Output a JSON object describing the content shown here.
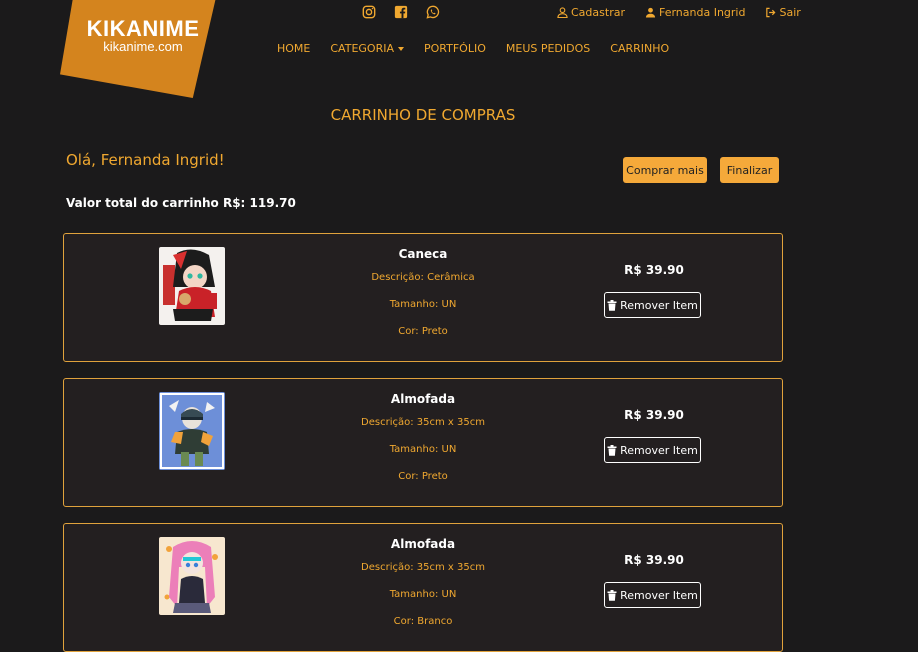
{
  "brand": {
    "name": "KIKANIME",
    "domain": "kikanime.com",
    "color": "#d4841e"
  },
  "social": [
    "instagram-icon",
    "facebook-icon",
    "whatsapp-icon"
  ],
  "user_nav": {
    "register": "Cadastrar",
    "user": "Fernanda Ingrid",
    "logout": "Sair"
  },
  "nav": {
    "home": "HOME",
    "category": "CATEGORIA",
    "portfolio": "PORTFÓLIO",
    "orders": "MEUS PEDIDOS",
    "cart": "CARRINHO"
  },
  "page": {
    "title": "CARRINHO DE COMPRAS",
    "greeting": "Olá, Fernanda Ingrid!",
    "buy_more": "Comprar mais",
    "finish": "Finalizar",
    "total_label": "Valor total do carrinho R$: 119.70"
  },
  "items": [
    {
      "name": "Caneca",
      "description": "Descrição: Cerâmica",
      "size": "Tamanho: UN",
      "color": "Cor: Preto",
      "price": "R$ 39.90",
      "remove": "Remover Item"
    },
    {
      "name": "Almofada",
      "description": "Descrição: 35cm x 35cm",
      "size": "Tamanho: UN",
      "color": "Cor: Preto",
      "price": "R$ 39.90",
      "remove": "Remover Item"
    },
    {
      "name": "Almofada",
      "description": "Descrição: 35cm x 35cm",
      "size": "Tamanho: UN",
      "color": "Cor: Branco",
      "price": "R$ 39.90",
      "remove": "Remover Item"
    }
  ],
  "colors": {
    "accent": "#f0a830",
    "button": "#f5a93a",
    "background": "#1b1a1b",
    "card": "#231f20"
  }
}
